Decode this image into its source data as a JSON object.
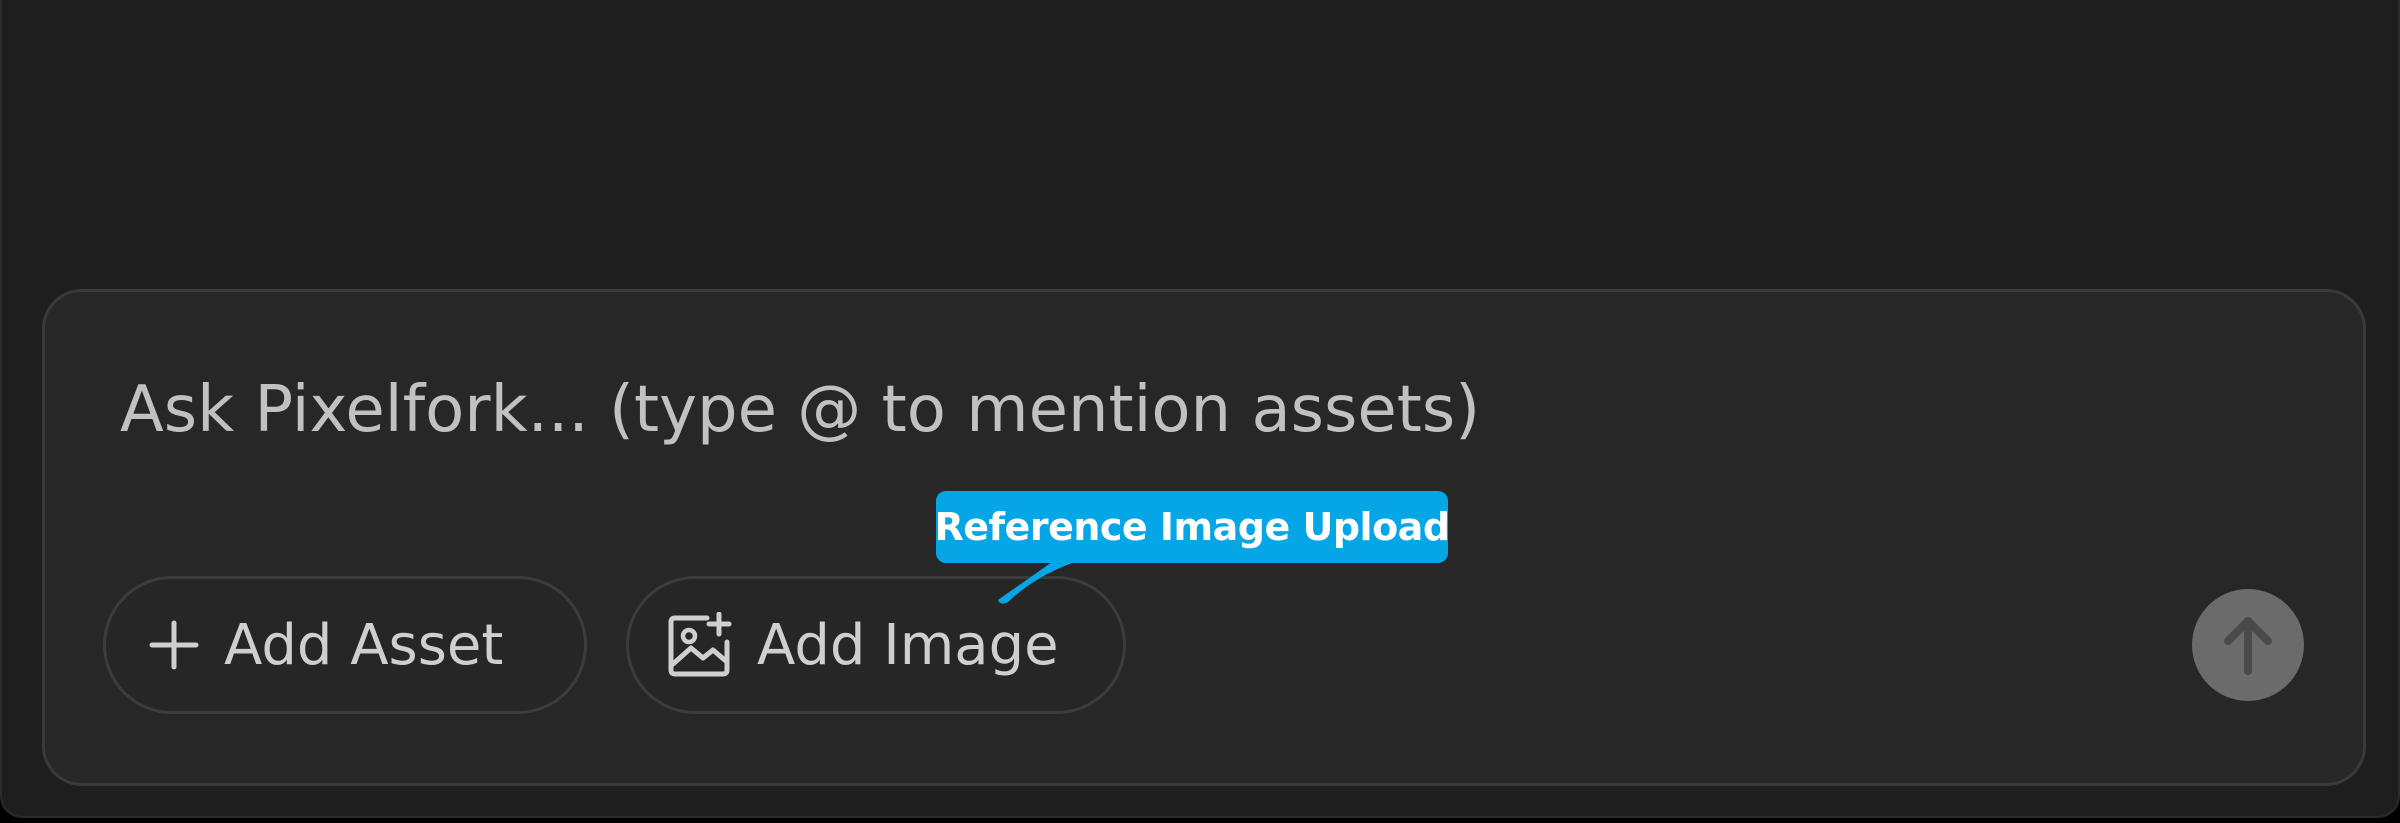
{
  "composer": {
    "placeholder": "Ask Pixelfork... (type @ to mention assets)",
    "value": ""
  },
  "actions": {
    "add_asset_label": "Add Asset",
    "add_image_label": "Add Image",
    "add_asset_icon": "plus-icon",
    "add_image_icon": "image-plus-icon"
  },
  "tooltip": {
    "text": "Reference Image Upload",
    "color": "#05a6e6"
  },
  "send": {
    "icon": "arrow-up-icon",
    "color": "#6b6b6b"
  }
}
